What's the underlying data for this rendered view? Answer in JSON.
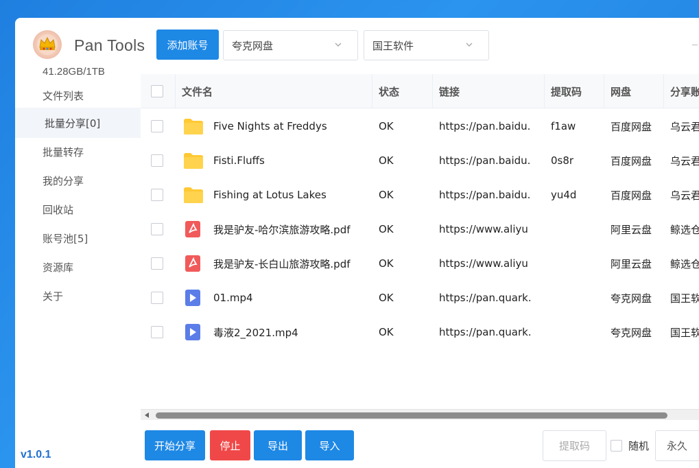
{
  "app": {
    "title": "Pan Tools",
    "storage": "41.28GB/1TB",
    "version": "v1.0.1"
  },
  "toolbar": {
    "add_account_label": "添加账号",
    "drive_select": "夸克网盘",
    "account_select": "国王软件"
  },
  "sidebar": {
    "items": [
      {
        "label": "文件列表",
        "active": false
      },
      {
        "label": "批量分享[0]",
        "active": true
      },
      {
        "label": "批量转存",
        "active": false
      },
      {
        "label": "我的分享",
        "active": false
      },
      {
        "label": "回收站",
        "active": false
      },
      {
        "label": "账号池[5]",
        "active": false
      },
      {
        "label": "资源库",
        "active": false
      },
      {
        "label": "关于",
        "active": false
      }
    ]
  },
  "table": {
    "headers": [
      "文件名",
      "状态",
      "链接",
      "提取码",
      "网盘",
      "分享账"
    ],
    "rows": [
      {
        "icon": "folder-icon",
        "name": "Five Nights at Freddys",
        "status": "OK",
        "link": "https://pan.baidu.",
        "code": "f1aw",
        "drive": "百度网盘",
        "account": "乌云君"
      },
      {
        "icon": "folder-icon",
        "name": "Fisti.Fluffs",
        "status": "OK",
        "link": "https://pan.baidu.",
        "code": "0s8r",
        "drive": "百度网盘",
        "account": "乌云君"
      },
      {
        "icon": "folder-icon",
        "name": "Fishing at Lotus Lakes",
        "status": "OK",
        "link": "https://pan.baidu.",
        "code": "yu4d",
        "drive": "百度网盘",
        "account": "乌云君"
      },
      {
        "icon": "pdf-icon",
        "name": "我是驴友-哈尔滨旅游攻略.pdf",
        "status": "OK",
        "link": "https://www.aliyu",
        "code": "",
        "drive": "阿里云盘",
        "account": "鲸选仓"
      },
      {
        "icon": "pdf-icon",
        "name": "我是驴友-长白山旅游攻略.pdf",
        "status": "OK",
        "link": "https://www.aliyu",
        "code": "",
        "drive": "阿里云盘",
        "account": "鲸选仓"
      },
      {
        "icon": "video-icon",
        "name": "01.mp4",
        "status": "OK",
        "link": "https://pan.quark.",
        "code": "",
        "drive": "夸克网盘",
        "account": "国王软"
      },
      {
        "icon": "video-icon",
        "name": "毒液2_2021.mp4",
        "status": "OK",
        "link": "https://pan.quark.",
        "code": "",
        "drive": "夸克网盘",
        "account": "国王软"
      }
    ]
  },
  "bottom": {
    "start_label": "开始分享",
    "stop_label": "停止",
    "export_label": "导出",
    "import_label": "导入",
    "code_placeholder": "提取码",
    "random_label": "随机",
    "expire_select": "永久"
  },
  "colors": {
    "primary": "#1e88e5",
    "danger": "#f04848",
    "folder": "#ffc935",
    "pdf": "#f15a5a",
    "video": "#5b7de8"
  }
}
